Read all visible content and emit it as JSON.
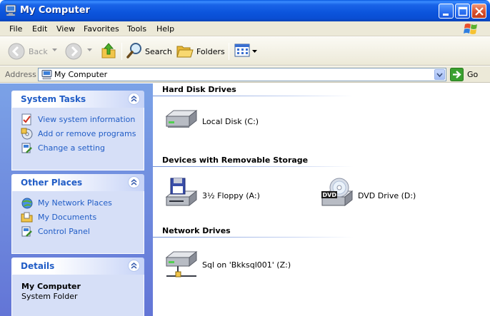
{
  "window": {
    "title": "My Computer"
  },
  "menu": [
    "File",
    "Edit",
    "View",
    "Favorites",
    "Tools",
    "Help"
  ],
  "toolbar": {
    "back_label": "Back",
    "search_label": "Search",
    "folders_label": "Folders"
  },
  "address": {
    "label": "Address",
    "value": "My Computer",
    "go_label": "Go"
  },
  "system_tasks": {
    "title": "System Tasks",
    "items": [
      {
        "label": "View system information",
        "icon": "system-info-icon"
      },
      {
        "label": "Add or remove programs",
        "icon": "add-remove-programs-icon"
      },
      {
        "label": "Change a setting",
        "icon": "control-setting-icon"
      }
    ]
  },
  "other_places": {
    "title": "Other Places",
    "items": [
      {
        "label": "My Network Places",
        "icon": "network-places-icon"
      },
      {
        "label": "My Documents",
        "icon": "my-documents-icon"
      },
      {
        "label": "Control Panel",
        "icon": "control-panel-icon"
      }
    ]
  },
  "details": {
    "title": "Details",
    "name": "My Computer",
    "subtitle": "System Folder"
  },
  "groups": [
    {
      "title": "Hard Disk Drives",
      "items": [
        {
          "label": "Local Disk (C:)",
          "icon": "hard-disk-icon"
        }
      ]
    },
    {
      "title": "Devices with Removable Storage",
      "items": [
        {
          "label": "3½ Floppy (A:)",
          "icon": "floppy-drive-icon"
        },
        {
          "label": "DVD Drive (D:)",
          "icon": "dvd-drive-icon"
        }
      ]
    },
    {
      "title": "Network Drives",
      "items": [
        {
          "label": "Sql on 'Bkksql001' (Z:)",
          "icon": "network-drive-icon"
        }
      ]
    }
  ],
  "colors": {
    "titlebar": "#0a54dc",
    "taskpane": "#7ba2e7",
    "link": "#215dc6",
    "chrome": "#ece9d8"
  }
}
